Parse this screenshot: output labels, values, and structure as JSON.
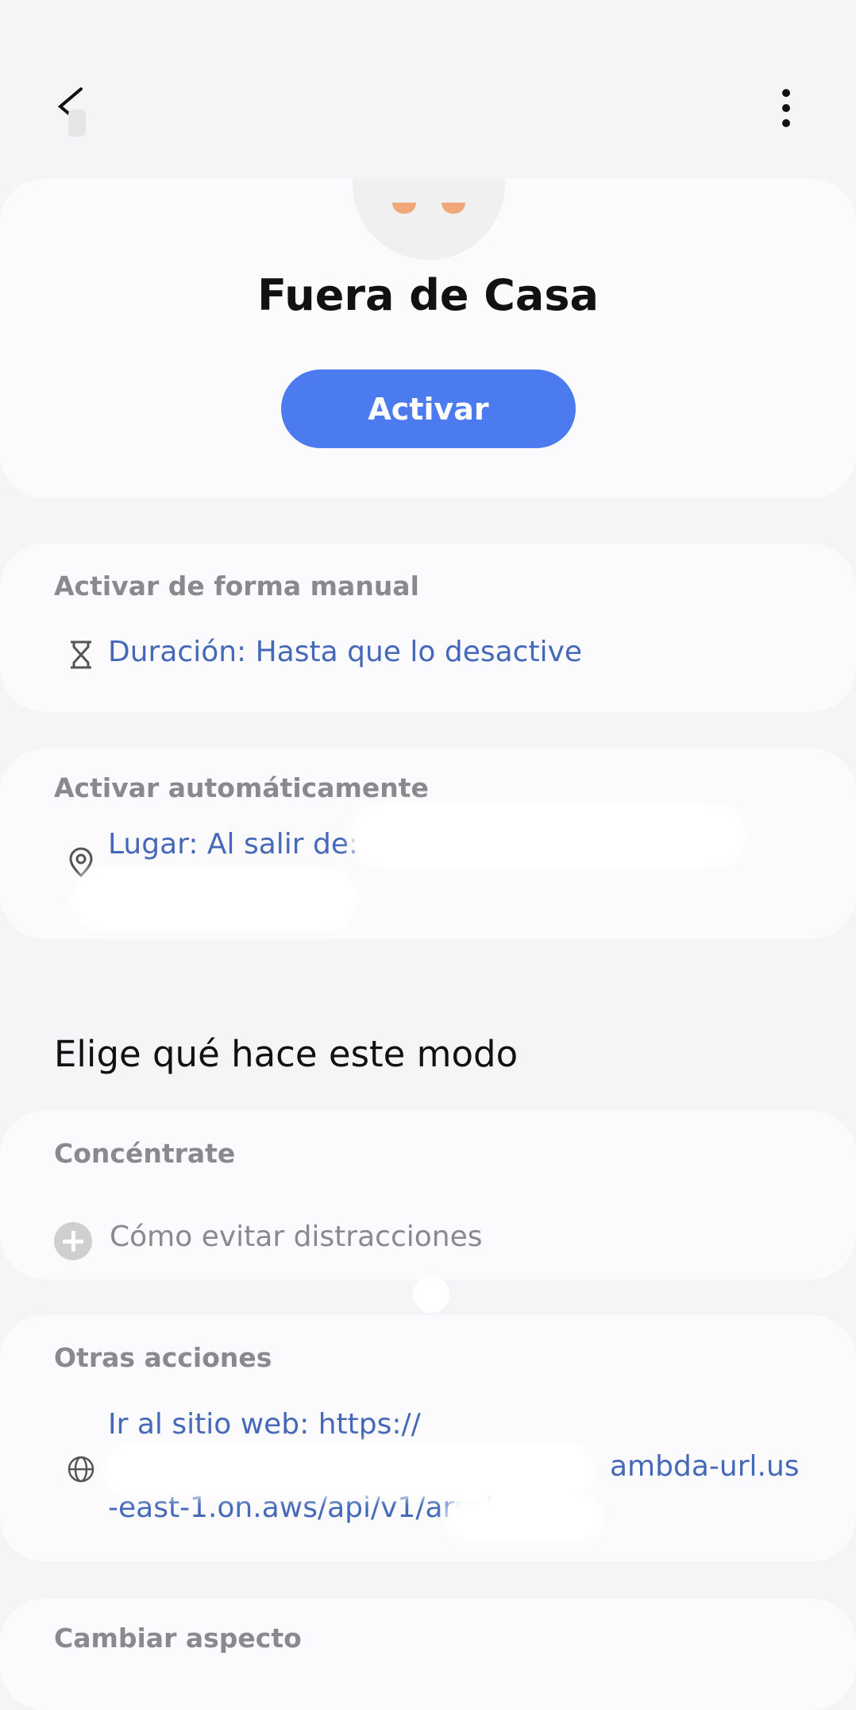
{
  "header": {
    "back_icon": "back-arrow-icon",
    "menu_icon": "more-vert-icon"
  },
  "mode": {
    "title": "Fuera de Casa",
    "activate_label": "Activar"
  },
  "manual": {
    "label": "Activar de forma manual",
    "icon": "hourglass-icon",
    "duration": "Duración: Hasta que lo desactive"
  },
  "auto": {
    "label": "Activar automáticamente",
    "icon": "location-pin-icon",
    "place": "Lugar: Al salir de:"
  },
  "choose": {
    "heading": "Elige qué hace este modo"
  },
  "focus": {
    "label": "Concéntrate",
    "icon": "add-circle-icon",
    "item": "Cómo evitar distracciones"
  },
  "other": {
    "label": "Otras acciones",
    "icon": "globe-icon",
    "line1": "Ir al sitio web: https://",
    "line2_suffix": "ambda-url.us",
    "line3": "-east-1.on.aws/api/v1/arm/"
  },
  "look": {
    "label": "Cambiar aspecto"
  },
  "colors": {
    "accent": "#4b7bef",
    "link": "#4569b8",
    "background": "#f5f5f7",
    "card": "#fbfbfd"
  }
}
